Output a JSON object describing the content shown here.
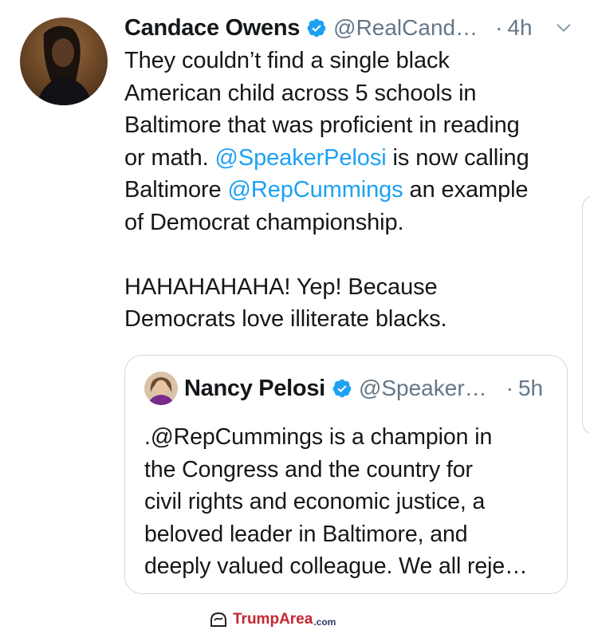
{
  "tweet": {
    "author_name": "Candace Owens",
    "author_handle": "@RealCand…",
    "time": "4h",
    "lines": [
      "They couldn’t find a single black",
      "American child across 5 schools in",
      "Baltimore that was proficient in reading",
      "or math. ",
      "@SpeakerPelosi",
      " is now calling",
      "Baltimore ",
      "@RepCummings",
      " an example",
      "of Democrat championship.",
      "HAHAHAHAHA! Yep! Because",
      "Democrats love illiterate blacks."
    ]
  },
  "quoted": {
    "author_name": "Nancy Pelosi",
    "author_handle": "@Speaker…",
    "time": "5h",
    "lines": [
      ".@RepCummings is a champion in",
      "the Congress and the country for",
      "civil rights and economic justice, a",
      "beloved leader in Baltimore, and",
      "deeply valued colleague. We all reje…"
    ]
  },
  "watermark": {
    "part1": "Trump",
    "part2": "Area",
    "part3": ".com"
  },
  "icons": {
    "verified": "verified-badge-icon",
    "chevron": "chevron-down-icon"
  },
  "colors": {
    "link": "#1da1f2",
    "muted": "#657786",
    "border": "#ccd6dd",
    "watermark_red": "#c3262f",
    "watermark_navy": "#2b3a67"
  }
}
